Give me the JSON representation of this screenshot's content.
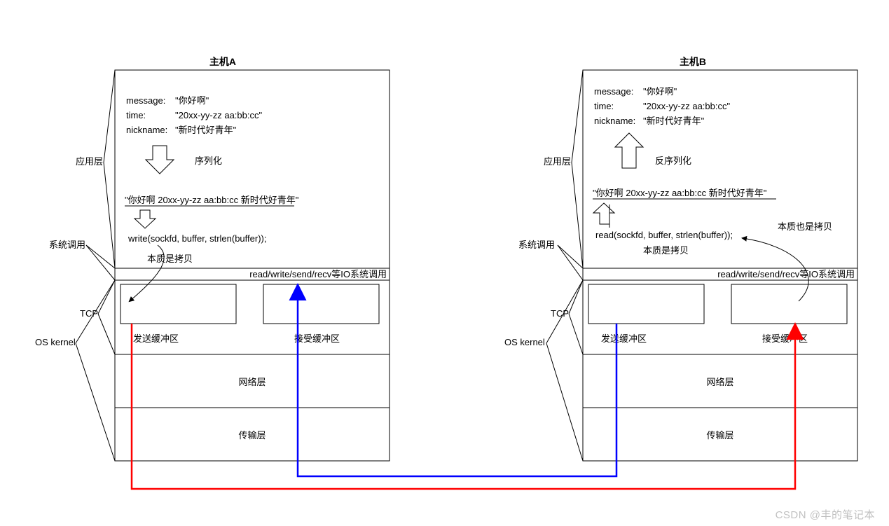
{
  "hostA": {
    "title": "主机A",
    "msg_label": "message:",
    "msg_value": "\"你好啊\"",
    "time_label": "time:",
    "time_value": "\"20xx-yy-zz aa:bb:cc\"",
    "nick_label": "nickname:",
    "nick_value": "\"新时代好青年\"",
    "arrow1_label": "序列化",
    "serialized": "\"你好啊 20xx-yy-zz aa:bb:cc 新时代好青年\"",
    "call": "write(sockfd, buffer, strlen(buffer));",
    "copy_note": "本质是拷贝",
    "io_label": "read/write/send/recv等IO系统调用",
    "send_buf": "发送缓冲区",
    "recv_buf": "接受缓冲区",
    "net_layer": "网络层",
    "trans_layer": "传输层"
  },
  "hostB": {
    "title": "主机B",
    "msg_label": "message:",
    "msg_value": "\"你好啊\"",
    "time_label": "time:",
    "time_value": "\"20xx-yy-zz aa:bb:cc\"",
    "nick_label": "nickname:",
    "nick_value": "\"新时代好青年\"",
    "arrow1_label": "反序列化",
    "serialized": "\"你好啊 20xx-yy-zz aa:bb:cc 新时代好青年\"",
    "call": "read(sockfd, buffer, strlen(buffer));",
    "copy_note": "本质是拷贝",
    "copy_note2": "本质也是拷贝",
    "io_label": "read/write/send/recv等IO系统调用",
    "send_buf": "发送缓冲区",
    "recv_buf": "接受缓冲区",
    "net_layer": "网络层",
    "trans_layer": "传输层"
  },
  "side": {
    "app_layer": "应用层",
    "syscall": "系统调用",
    "tcp": "TCP",
    "os_kernel": "OS kernel"
  },
  "watermark": "CSDN @丰的笔记本"
}
